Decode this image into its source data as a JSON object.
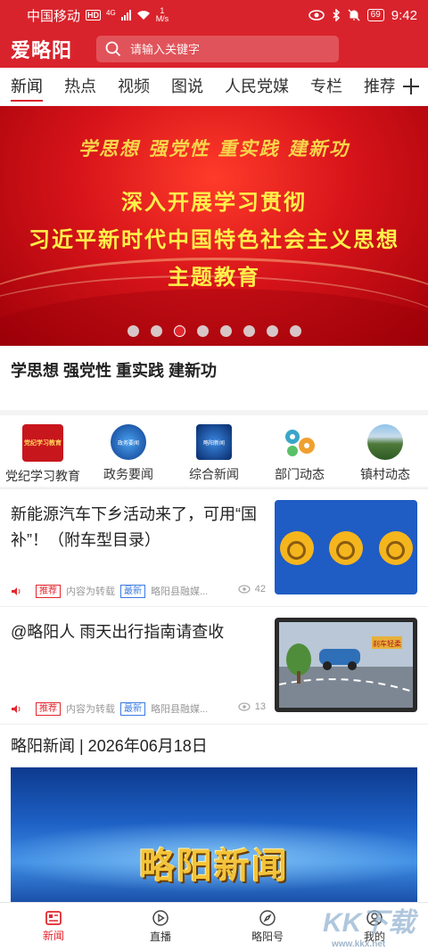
{
  "status_bar": {
    "carrier": "中国移动",
    "hd": "HD",
    "net": "4G",
    "speed_value": "1",
    "speed_unit": "M/s",
    "battery": "69",
    "time": "9:42"
  },
  "header": {
    "brand": "爱略阳",
    "search_placeholder": "请输入关键字"
  },
  "tabs": [
    "新闻",
    "热点",
    "视频",
    "图说",
    "人民党媒",
    "专栏",
    "推荐"
  ],
  "banner": {
    "tagline": "学思想  强党性  重实践  建新功",
    "lines": [
      "深入开展学习贯彻",
      "习近平新时代中国特色社会主义思想",
      "主题教育"
    ],
    "dot_count": 8,
    "active_dot": 2,
    "caption": "学思想 强党性 重实践 建新功"
  },
  "categories": [
    {
      "label": "党纪学习教育",
      "icon_text": "党纪学习教育"
    },
    {
      "label": "政务要闻",
      "icon_text": "政务要闻"
    },
    {
      "label": "综合新闻",
      "icon_text": "略阳新闻"
    },
    {
      "label": "部门动态",
      "icon_text": ""
    },
    {
      "label": "镇村动态",
      "icon_text": ""
    }
  ],
  "news": [
    {
      "title": "新能源汽车下乡活动来了，可用“国补”！（附车型目录）",
      "badge_recommend": "推荐",
      "source_note": "内容为转载",
      "badge_new": "最新",
      "source": "略阳县融媒...",
      "views": "42"
    },
    {
      "title": "@略阳人 雨天出行指南请查收",
      "badge_recommend": "推荐",
      "source_note": "内容为转载",
      "badge_new": "最新",
      "source": "略阳县融媒...",
      "views": "13",
      "thumb_sign": "刹车轻柔"
    }
  ],
  "section": {
    "title": "略阳新闻 | 2026年06月18日",
    "image_text": "略阳新闻"
  },
  "bottom_nav": [
    "新闻",
    "直播",
    "略阳号",
    "我的"
  ],
  "watermark": {
    "main": "KK下载",
    "sub": "www.kkx.net"
  },
  "colors": {
    "brand_red": "#d9232c",
    "badge_blue": "#3a7be0"
  }
}
